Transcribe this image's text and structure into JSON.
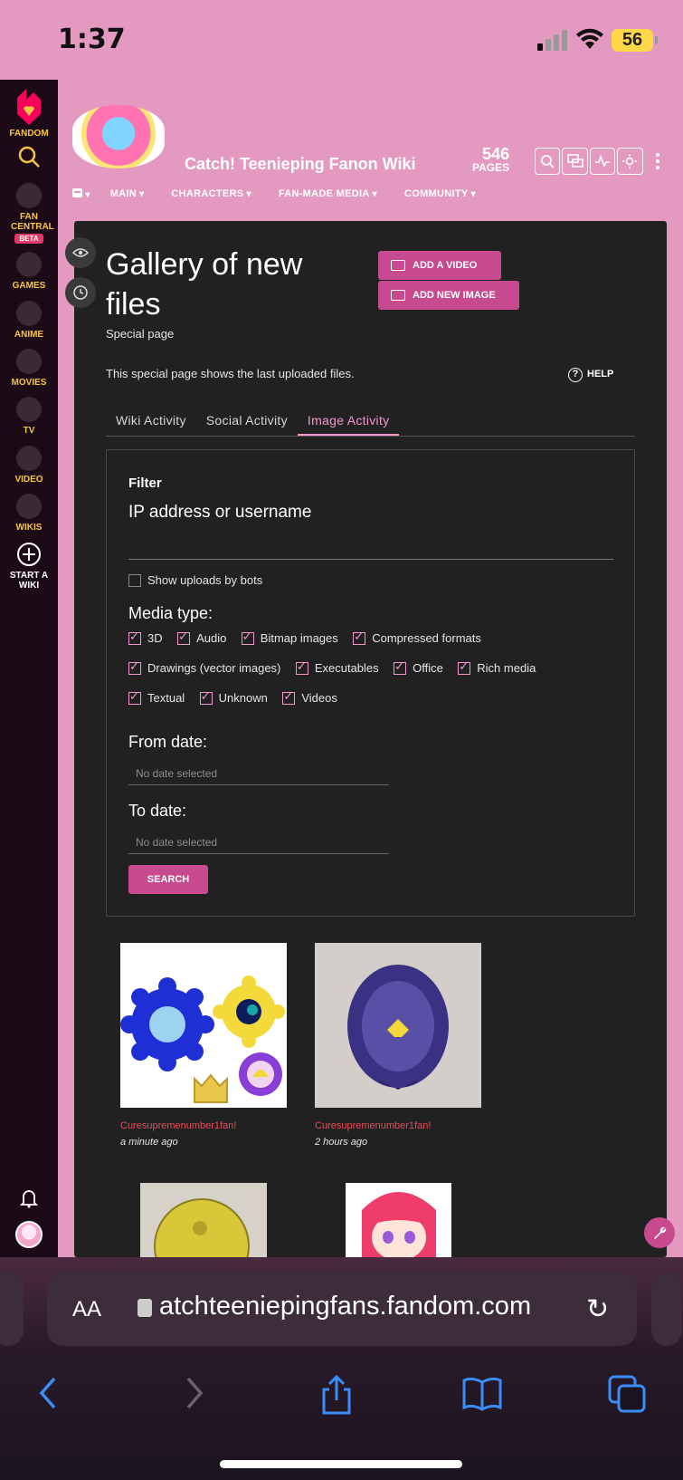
{
  "status_bar": {
    "time": "1:37",
    "battery": "56"
  },
  "rail": {
    "items": [
      {
        "label": "FANDOM"
      },
      {
        "label": ""
      },
      {
        "label": "FAN CENTRAL",
        "badge": "BETA"
      },
      {
        "label": "GAMES"
      },
      {
        "label": "ANIME"
      },
      {
        "label": "MOVIES"
      },
      {
        "label": "TV"
      },
      {
        "label": "VIDEO"
      },
      {
        "label": "WIKIS"
      },
      {
        "label": "START A WIKI"
      }
    ]
  },
  "wiki": {
    "title": "Catch! Teenieping Fanon Wiki",
    "page_count": "546",
    "page_count_label": "PAGES",
    "nav": [
      "MAIN",
      "CHARACTERS",
      "FAN-MADE MEDIA",
      "COMMUNITY"
    ]
  },
  "page": {
    "title": "Gallery of new files",
    "subtitle": "Special page",
    "add_video": "ADD A VIDEO",
    "add_image": "ADD NEW IMAGE",
    "description": "This special page shows the last uploaded files.",
    "help": "HELP",
    "tabs": [
      "Wiki Activity",
      "Social Activity",
      "Image Activity"
    ]
  },
  "filter": {
    "title": "Filter",
    "ip_label": "IP address or username",
    "bots_label": "Show uploads by bots",
    "media_type_label": "Media type:",
    "media_types": [
      "3D",
      "Audio",
      "Bitmap images",
      "Compressed formats",
      "Drawings (vector images)",
      "Executables",
      "Office",
      "Rich media",
      "Textual",
      "Unknown",
      "Videos"
    ],
    "from_label": "From date:",
    "to_label": "To date:",
    "date_placeholder": "No date selected",
    "search": "SEARCH"
  },
  "gallery": [
    {
      "user": "Curesupremenumber1fan!",
      "time": "a minute ago"
    },
    {
      "user": "Curesupremenumber1fan!",
      "time": "2 hours ago"
    }
  ],
  "safari": {
    "aa": "AA",
    "url": "atchteeniepingfans.fandom.com"
  },
  "colors": {
    "accent": "#c74a8e",
    "header_pink": "#e49ac0",
    "panel": "#212121",
    "rail": "#1c0b16",
    "tab_active": "#f29ad0"
  }
}
